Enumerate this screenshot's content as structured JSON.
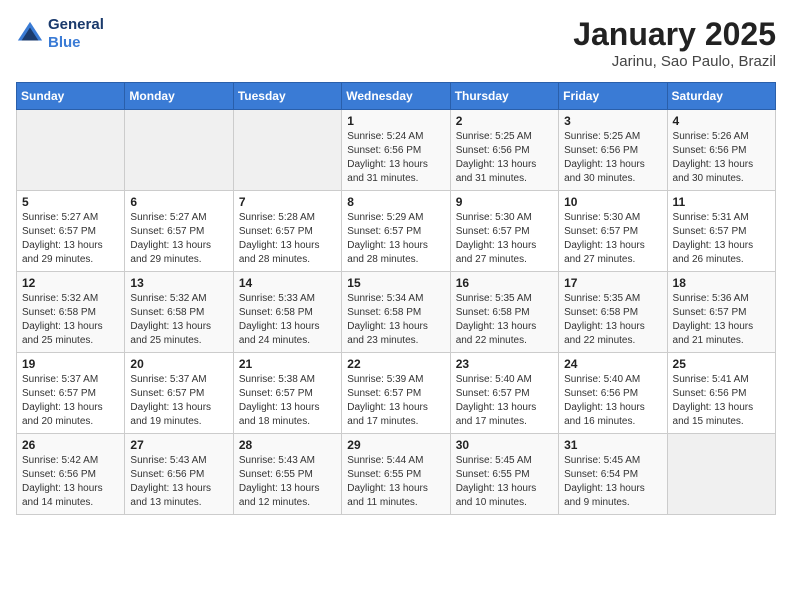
{
  "header": {
    "logo_line1": "General",
    "logo_line2": "Blue",
    "month": "January 2025",
    "location": "Jarinu, Sao Paulo, Brazil"
  },
  "weekdays": [
    "Sunday",
    "Monday",
    "Tuesday",
    "Wednesday",
    "Thursday",
    "Friday",
    "Saturday"
  ],
  "weeks": [
    [
      {
        "day": "",
        "detail": ""
      },
      {
        "day": "",
        "detail": ""
      },
      {
        "day": "",
        "detail": ""
      },
      {
        "day": "1",
        "detail": "Sunrise: 5:24 AM\nSunset: 6:56 PM\nDaylight: 13 hours\nand 31 minutes."
      },
      {
        "day": "2",
        "detail": "Sunrise: 5:25 AM\nSunset: 6:56 PM\nDaylight: 13 hours\nand 31 minutes."
      },
      {
        "day": "3",
        "detail": "Sunrise: 5:25 AM\nSunset: 6:56 PM\nDaylight: 13 hours\nand 30 minutes."
      },
      {
        "day": "4",
        "detail": "Sunrise: 5:26 AM\nSunset: 6:56 PM\nDaylight: 13 hours\nand 30 minutes."
      }
    ],
    [
      {
        "day": "5",
        "detail": "Sunrise: 5:27 AM\nSunset: 6:57 PM\nDaylight: 13 hours\nand 29 minutes."
      },
      {
        "day": "6",
        "detail": "Sunrise: 5:27 AM\nSunset: 6:57 PM\nDaylight: 13 hours\nand 29 minutes."
      },
      {
        "day": "7",
        "detail": "Sunrise: 5:28 AM\nSunset: 6:57 PM\nDaylight: 13 hours\nand 28 minutes."
      },
      {
        "day": "8",
        "detail": "Sunrise: 5:29 AM\nSunset: 6:57 PM\nDaylight: 13 hours\nand 28 minutes."
      },
      {
        "day": "9",
        "detail": "Sunrise: 5:30 AM\nSunset: 6:57 PM\nDaylight: 13 hours\nand 27 minutes."
      },
      {
        "day": "10",
        "detail": "Sunrise: 5:30 AM\nSunset: 6:57 PM\nDaylight: 13 hours\nand 27 minutes."
      },
      {
        "day": "11",
        "detail": "Sunrise: 5:31 AM\nSunset: 6:57 PM\nDaylight: 13 hours\nand 26 minutes."
      }
    ],
    [
      {
        "day": "12",
        "detail": "Sunrise: 5:32 AM\nSunset: 6:58 PM\nDaylight: 13 hours\nand 25 minutes."
      },
      {
        "day": "13",
        "detail": "Sunrise: 5:32 AM\nSunset: 6:58 PM\nDaylight: 13 hours\nand 25 minutes."
      },
      {
        "day": "14",
        "detail": "Sunrise: 5:33 AM\nSunset: 6:58 PM\nDaylight: 13 hours\nand 24 minutes."
      },
      {
        "day": "15",
        "detail": "Sunrise: 5:34 AM\nSunset: 6:58 PM\nDaylight: 13 hours\nand 23 minutes."
      },
      {
        "day": "16",
        "detail": "Sunrise: 5:35 AM\nSunset: 6:58 PM\nDaylight: 13 hours\nand 22 minutes."
      },
      {
        "day": "17",
        "detail": "Sunrise: 5:35 AM\nSunset: 6:58 PM\nDaylight: 13 hours\nand 22 minutes."
      },
      {
        "day": "18",
        "detail": "Sunrise: 5:36 AM\nSunset: 6:57 PM\nDaylight: 13 hours\nand 21 minutes."
      }
    ],
    [
      {
        "day": "19",
        "detail": "Sunrise: 5:37 AM\nSunset: 6:57 PM\nDaylight: 13 hours\nand 20 minutes."
      },
      {
        "day": "20",
        "detail": "Sunrise: 5:37 AM\nSunset: 6:57 PM\nDaylight: 13 hours\nand 19 minutes."
      },
      {
        "day": "21",
        "detail": "Sunrise: 5:38 AM\nSunset: 6:57 PM\nDaylight: 13 hours\nand 18 minutes."
      },
      {
        "day": "22",
        "detail": "Sunrise: 5:39 AM\nSunset: 6:57 PM\nDaylight: 13 hours\nand 17 minutes."
      },
      {
        "day": "23",
        "detail": "Sunrise: 5:40 AM\nSunset: 6:57 PM\nDaylight: 13 hours\nand 17 minutes."
      },
      {
        "day": "24",
        "detail": "Sunrise: 5:40 AM\nSunset: 6:56 PM\nDaylight: 13 hours\nand 16 minutes."
      },
      {
        "day": "25",
        "detail": "Sunrise: 5:41 AM\nSunset: 6:56 PM\nDaylight: 13 hours\nand 15 minutes."
      }
    ],
    [
      {
        "day": "26",
        "detail": "Sunrise: 5:42 AM\nSunset: 6:56 PM\nDaylight: 13 hours\nand 14 minutes."
      },
      {
        "day": "27",
        "detail": "Sunrise: 5:43 AM\nSunset: 6:56 PM\nDaylight: 13 hours\nand 13 minutes."
      },
      {
        "day": "28",
        "detail": "Sunrise: 5:43 AM\nSunset: 6:55 PM\nDaylight: 13 hours\nand 12 minutes."
      },
      {
        "day": "29",
        "detail": "Sunrise: 5:44 AM\nSunset: 6:55 PM\nDaylight: 13 hours\nand 11 minutes."
      },
      {
        "day": "30",
        "detail": "Sunrise: 5:45 AM\nSunset: 6:55 PM\nDaylight: 13 hours\nand 10 minutes."
      },
      {
        "day": "31",
        "detail": "Sunrise: 5:45 AM\nSunset: 6:54 PM\nDaylight: 13 hours\nand 9 minutes."
      },
      {
        "day": "",
        "detail": ""
      }
    ]
  ]
}
